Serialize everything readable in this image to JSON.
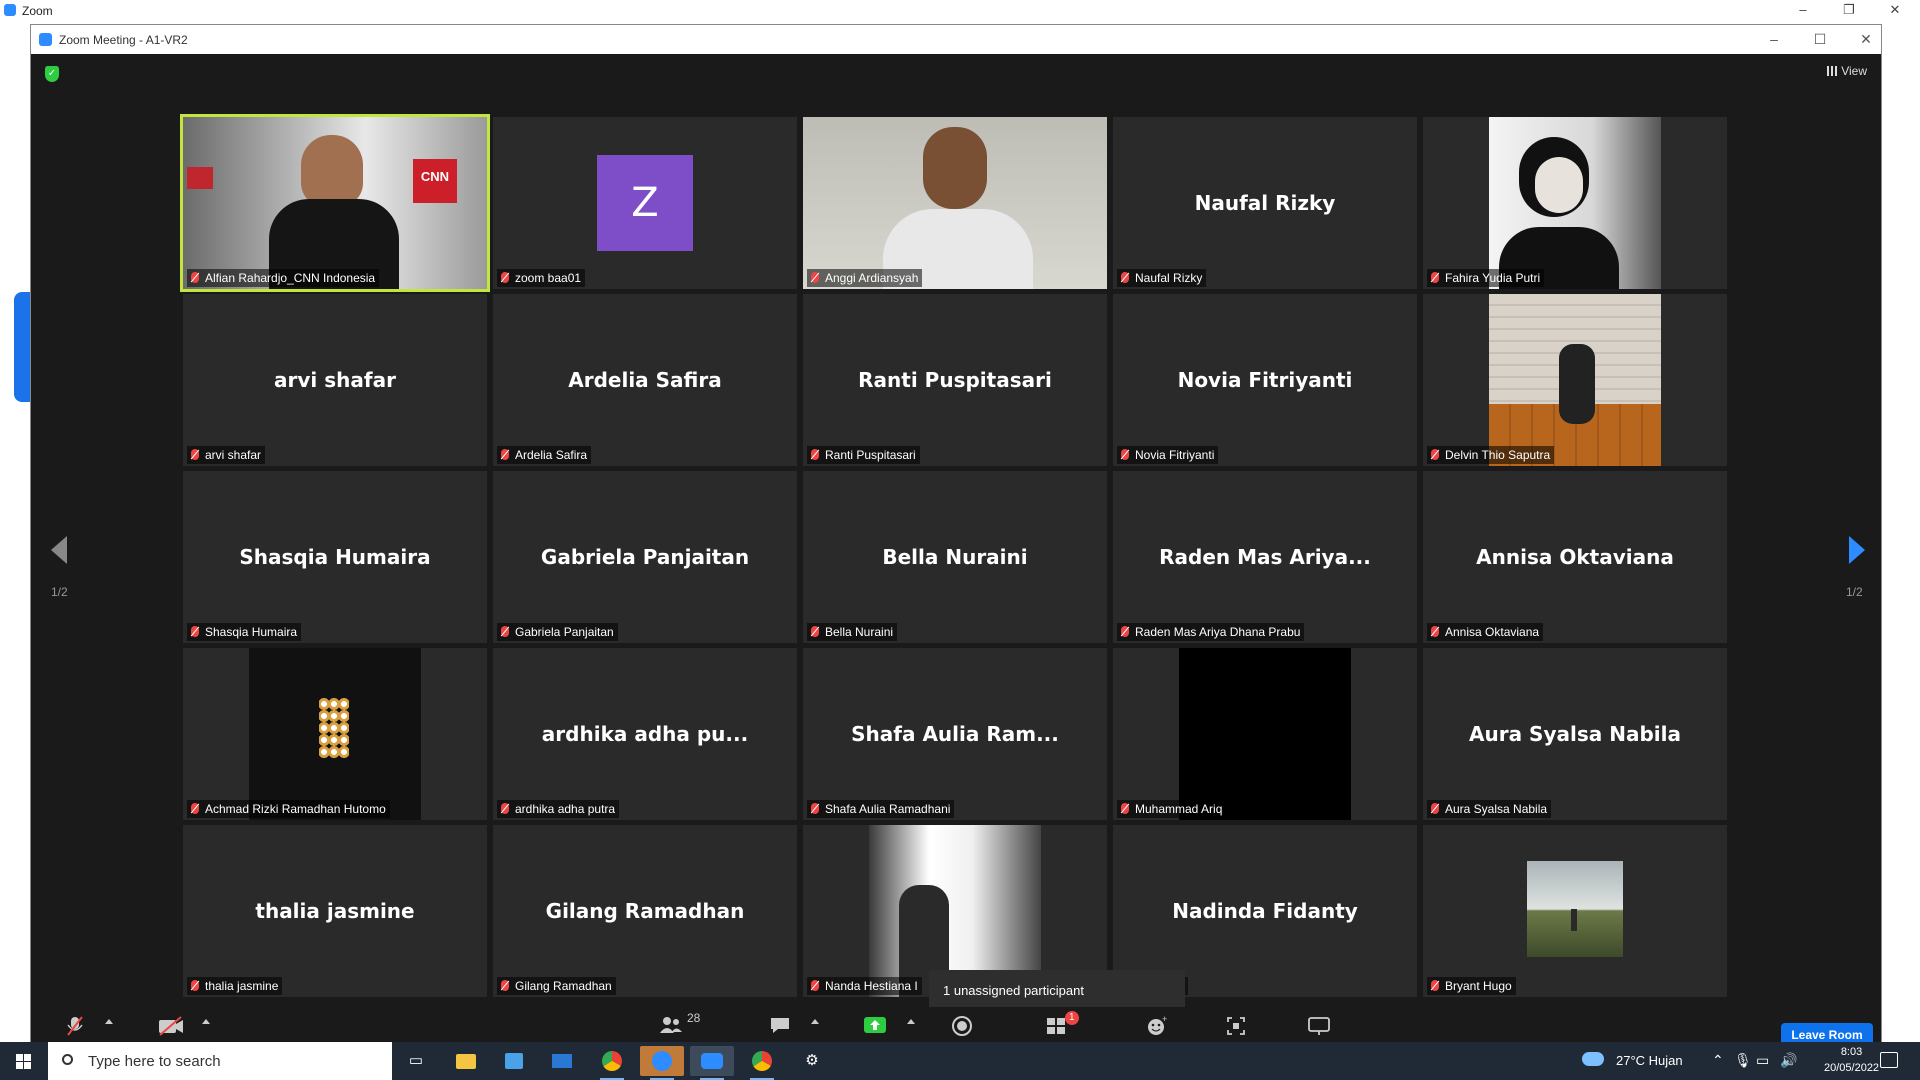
{
  "bg_window": {
    "title": "Zoom",
    "controls": [
      "–",
      "❐",
      "✕"
    ]
  },
  "window": {
    "title": "Zoom Meeting - A1-VR2",
    "controls": [
      "–",
      "☐",
      "✕"
    ]
  },
  "view_label": "View",
  "page_left": "1/2",
  "page_right": "1/2",
  "tiles": [
    {
      "label": "Alfian Rahardjo_CNN Indonesia",
      "big": "",
      "kind": "video-cnn",
      "active": true
    },
    {
      "label": "zoom baa01",
      "big": "",
      "kind": "avatar",
      "avatar": "Z"
    },
    {
      "label": "Anggi Ardiansyah",
      "big": "",
      "kind": "video-boy"
    },
    {
      "label": "Naufal Rizky",
      "big": "Naufal Rizky",
      "kind": "name"
    },
    {
      "label": "Fahira Yudia Putri",
      "big": "",
      "kind": "photo-girl"
    },
    {
      "label": "arvi shafar",
      "big": "arvi shafar",
      "kind": "name"
    },
    {
      "label": "Ardelia Safira",
      "big": "Ardelia Safira",
      "kind": "name"
    },
    {
      "label": "Ranti Puspitasari",
      "big": "Ranti Puspitasari",
      "kind": "name"
    },
    {
      "label": "Novia Fitriyanti",
      "big": "Novia Fitriyanti",
      "kind": "name"
    },
    {
      "label": "Delvin Thio Saputra",
      "big": "",
      "kind": "photo-wood"
    },
    {
      "label": "Shasqia Humaira",
      "big": "Shasqia Humaira",
      "kind": "name"
    },
    {
      "label": "Gabriela Panjaitan",
      "big": "Gabriela Panjaitan",
      "kind": "name"
    },
    {
      "label": "Bella Nuraini",
      "big": "Bella Nuraini",
      "kind": "name"
    },
    {
      "label": "Raden Mas Ariya Dhana Prabu",
      "big": "Raden Mas Ariya...",
      "kind": "name"
    },
    {
      "label": "Annisa Oktaviana",
      "big": "Annisa Oktaviana",
      "kind": "name"
    },
    {
      "label": "Achmad Rizki Ramadhan Hutomo",
      "big": "",
      "kind": "photo-dark"
    },
    {
      "label": "ardhika adha putra",
      "big": "ardhika adha pu...",
      "kind": "name"
    },
    {
      "label": "Shafa Aulia Ramadhani",
      "big": "Shafa Aulia Ram...",
      "kind": "name"
    },
    {
      "label": "Muhammad Ariq",
      "big": "",
      "kind": "photo-black"
    },
    {
      "label": "Aura Syalsa Nabila",
      "big": "Aura Syalsa Nabila",
      "kind": "name"
    },
    {
      "label": "thalia jasmine",
      "big": "thalia jasmine",
      "kind": "name"
    },
    {
      "label": "Gilang Ramadhan",
      "big": "Gilang Ramadhan",
      "kind": "name"
    },
    {
      "label": "Nanda Hestiana I",
      "big": "",
      "kind": "photo-window"
    },
    {
      "label": "a Fidanty",
      "big": "Nadinda Fidanty",
      "kind": "name"
    },
    {
      "label": "Bryant Hugo",
      "big": "",
      "kind": "photo-landscape"
    }
  ],
  "tooltip": "1 unassigned participant",
  "toolbar": {
    "participants_count": "28",
    "reactions_badge": "1",
    "leave_label": "Leave Room"
  },
  "taskbar": {
    "search_placeholder": "Type here to search",
    "weather": "27°C  Hujan",
    "time": "8:03",
    "date": "20/05/2022"
  },
  "colors": {
    "accent": "#2d8cff",
    "active_outline": "#c3e63e",
    "leave": "#0e72ed",
    "muted": "#ee4444"
  }
}
